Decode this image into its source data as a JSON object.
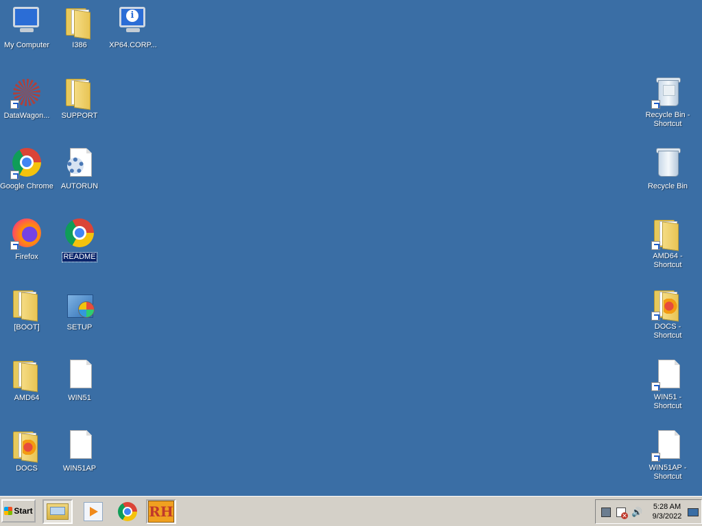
{
  "desktop": {
    "background_color": "#3a6ea5",
    "icons": [
      {
        "label": "My Computer",
        "type": "computer"
      },
      {
        "label": "I386",
        "type": "folder"
      },
      {
        "label": "XP64.CORP...",
        "type": "computer-info"
      },
      {
        "label": "DataWagon...",
        "type": "datawagon",
        "shortcut": true
      },
      {
        "label": "SUPPORT",
        "type": "folder"
      },
      {
        "label": "Google Chrome",
        "type": "chrome",
        "shortcut": true
      },
      {
        "label": "AUTORUN",
        "type": "gear-doc"
      },
      {
        "label": "Firefox",
        "type": "firefox",
        "shortcut": true
      },
      {
        "label": "README",
        "type": "chrome",
        "selected": true
      },
      {
        "label": "[BOOT]",
        "type": "folder"
      },
      {
        "label": "SETUP",
        "type": "setup"
      },
      {
        "label": "AMD64",
        "type": "folder"
      },
      {
        "label": "WIN51",
        "type": "document"
      },
      {
        "label": "DOCS",
        "type": "docs-folder"
      },
      {
        "label": "WIN51AP",
        "type": "document"
      },
      {
        "label": "Recycle Bin - Shortcut",
        "type": "recycle-bin",
        "shortcut": true
      },
      {
        "label": "Recycle Bin",
        "type": "recycle-bin"
      },
      {
        "label": "AMD64 - Shortcut",
        "type": "folder",
        "shortcut": true
      },
      {
        "label": "DOCS - Shortcut",
        "type": "docs-folder",
        "shortcut": true
      },
      {
        "label": "WIN51 - Shortcut",
        "type": "document",
        "shortcut": true
      },
      {
        "label": "WIN51AP - Shortcut",
        "type": "document",
        "shortcut": true
      }
    ]
  },
  "taskbar": {
    "start_label": "Start",
    "quick_launch": [
      {
        "name": "file-explorer",
        "active": true
      },
      {
        "name": "media-player",
        "active": false
      },
      {
        "name": "chrome",
        "active": false
      },
      {
        "name": "rh",
        "active": true,
        "text": "RH"
      }
    ],
    "tray": {
      "time": "5:28 AM",
      "date": "9/3/2022",
      "volume_glyph": "🔊"
    }
  }
}
